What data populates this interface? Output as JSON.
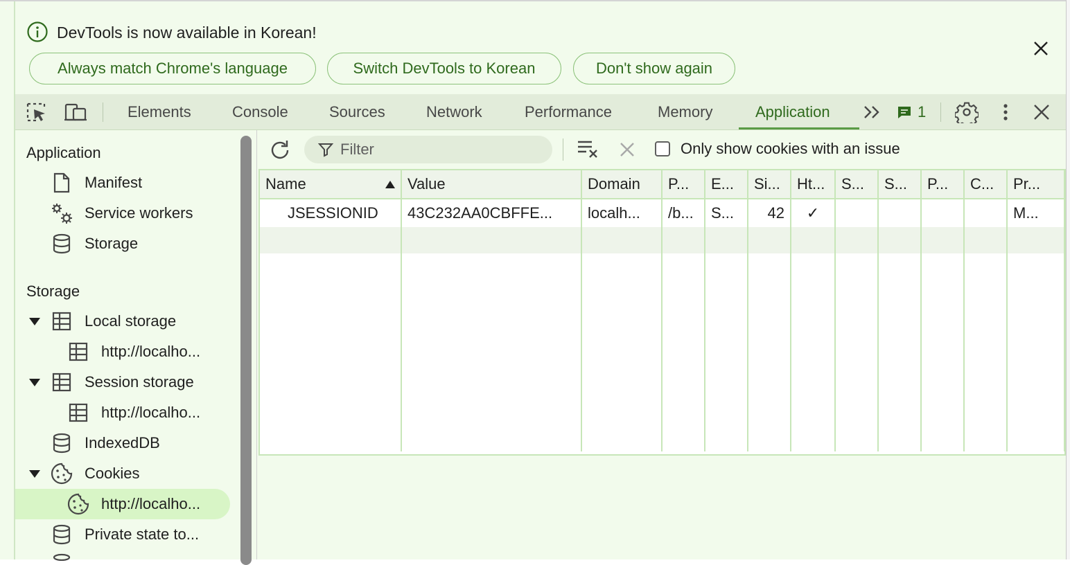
{
  "infobar": {
    "message": "DevTools is now available in Korean!",
    "buttons": {
      "match": "Always match Chrome's language",
      "switch": "Switch DevTools to Korean",
      "dont_show": "Don't show again"
    }
  },
  "tabs": [
    {
      "label": "Elements"
    },
    {
      "label": "Console"
    },
    {
      "label": "Sources"
    },
    {
      "label": "Network"
    },
    {
      "label": "Performance"
    },
    {
      "label": "Memory"
    },
    {
      "label": "Application",
      "active": true
    }
  ],
  "issues_count": "1",
  "sidebar": {
    "application_header": "Application",
    "manifest": "Manifest",
    "service_workers": "Service workers",
    "storage": "Storage",
    "storage_header": "Storage",
    "local_storage": "Local storage",
    "local_storage_origin": "http://localho...",
    "session_storage": "Session storage",
    "session_storage_origin": "http://localho...",
    "indexeddb": "IndexedDB",
    "cookies": "Cookies",
    "cookies_origin": "http://localho...",
    "private_state": "Private state to..."
  },
  "cookie_toolbar": {
    "filter_placeholder": "Filter",
    "only_issues_label": "Only show cookies with an issue"
  },
  "table": {
    "columns": [
      "Name",
      "Value",
      "Domain",
      "P...",
      "E...",
      "Si...",
      "Ht...",
      "S...",
      "S...",
      "P...",
      "C...",
      "Pr..."
    ],
    "rows": [
      [
        "JSESSIONID",
        "43C232AA0CBFFE...",
        "localh...",
        "/b...",
        "S...",
        "42",
        "✓",
        "",
        "",
        "",
        "",
        "M..."
      ]
    ]
  },
  "colors": {
    "accent": "#2f6a1d",
    "background": "#f2fbec",
    "selected": "#d8f5c6"
  }
}
